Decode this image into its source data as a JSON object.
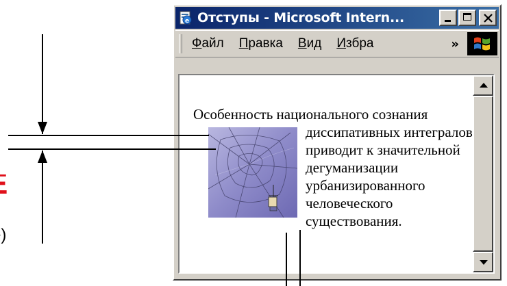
{
  "window": {
    "title": "Отступы - Microsoft Intern...",
    "icon": "ie-page-icon",
    "caption_buttons": [
      "minimize-icon",
      "maximize-icon",
      "close-icon"
    ]
  },
  "menu": {
    "items": [
      {
        "label": "Файл",
        "accel": "Ф",
        "rest": "айл"
      },
      {
        "label": "Правка",
        "accel": "П",
        "rest": "равка"
      },
      {
        "label": "Вид",
        "accel": "В",
        "rest": "ид"
      },
      {
        "label": "Избра",
        "accel": "И",
        "rest": "збра"
      }
    ],
    "overflow": "»",
    "throbber_icon": "windows-logo-icon"
  },
  "content": {
    "text_before": "Особенность национального сознания диссипативных",
    "text_after": "интегралов приводит к значительной дегуманизации урбанизированного человеческого существования.",
    "image_icon": "spider-web-image"
  },
  "annotation": {
    "partial_red_glyph": "Ё",
    "partial_text": "е)",
    "accent_color": "#e0101a"
  },
  "colors": {
    "title_start": "#0a246a",
    "title_end": "#3a6ea5",
    "face": "#d4d0c8"
  }
}
